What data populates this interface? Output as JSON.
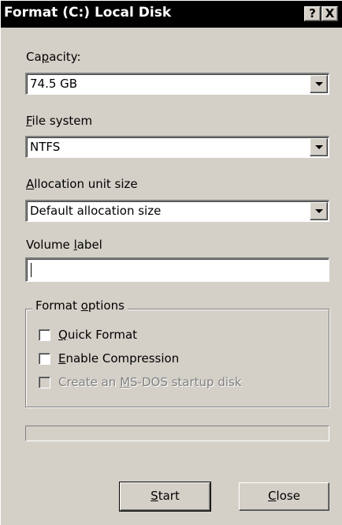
{
  "window": {
    "title": "Format (C:) Local Disk",
    "help_button": "?",
    "close_button": "X"
  },
  "capacity": {
    "label_pre": "Ca",
    "label_accel": "p",
    "label_post": "acity:",
    "value": "74.5 GB"
  },
  "file_system": {
    "label_accel": "F",
    "label_post": "ile system",
    "value": "NTFS"
  },
  "allocation": {
    "label_accel": "A",
    "label_post": "llocation unit size",
    "value": "Default allocation size"
  },
  "volume_label": {
    "label_pre": "Volume ",
    "label_accel": "l",
    "label_post": "abel",
    "value": ""
  },
  "format_options": {
    "legend_pre": "Format ",
    "legend_accel": "o",
    "legend_post": "ptions",
    "quick_format": {
      "accel": "Q",
      "rest": "uick Format",
      "checked": false,
      "enabled": true
    },
    "enable_compression": {
      "accel": "E",
      "rest": "nable Compression",
      "checked": false,
      "enabled": true
    },
    "ms_dos_startup": {
      "pre": "Create an ",
      "accel": "M",
      "rest": "S-DOS startup disk",
      "checked": false,
      "enabled": false
    }
  },
  "progress": {
    "value": 0
  },
  "buttons": {
    "start_accel": "S",
    "start_rest": "tart",
    "close_accel": "C",
    "close_rest": "lose"
  },
  "colors": {
    "face": "#d4d0c8",
    "title_bar": "#000000",
    "disabled_text": "#808080"
  }
}
